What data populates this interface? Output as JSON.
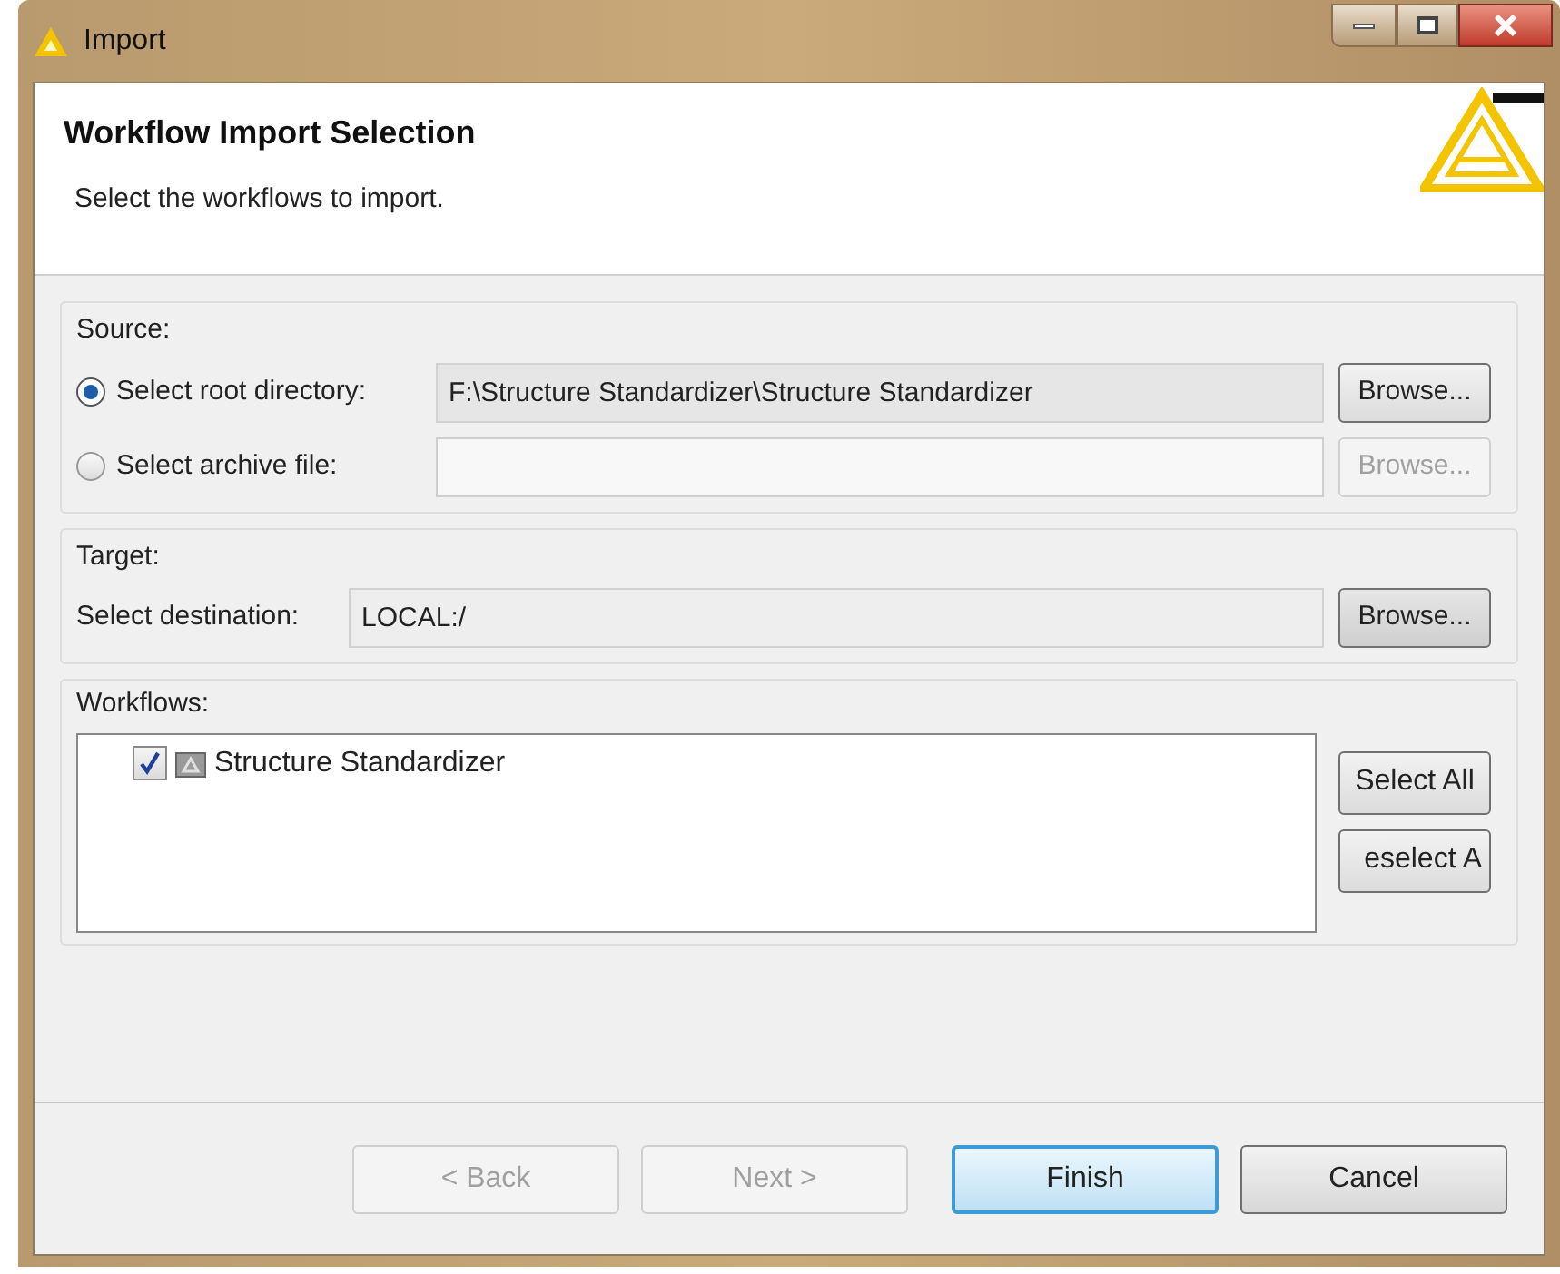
{
  "window": {
    "title": "Import"
  },
  "header": {
    "title": "Workflow Import Selection",
    "description": "Select the workflows to import."
  },
  "source": {
    "label": "Source:",
    "options": [
      {
        "label": "Select root directory:",
        "selected": true,
        "value": "F:\\Structure Standardizer\\Structure Standardizer",
        "browse": "Browse...",
        "disabled": false
      },
      {
        "label": "Select archive file:",
        "selected": false,
        "browse": "Browse...",
        "disabled": true
      }
    ]
  },
  "target": {
    "label": "Target:",
    "field_label": "Select destination:",
    "value": "LOCAL:/",
    "browse": "Browse..."
  },
  "workflows": {
    "label": "Workflows:",
    "items": [
      {
        "label": "Structure Standardizer",
        "checked": true
      }
    ],
    "buttons": [
      "Select All",
      "eselect A"
    ]
  },
  "buttons": [
    {
      "label": "< Back",
      "disabled": true,
      "default": false
    },
    {
      "label": "Next >",
      "disabled": true,
      "default": false
    },
    {
      "label": "Finish",
      "disabled": false,
      "default": true
    },
    {
      "label": "Cancel",
      "disabled": false,
      "default": false
    }
  ]
}
